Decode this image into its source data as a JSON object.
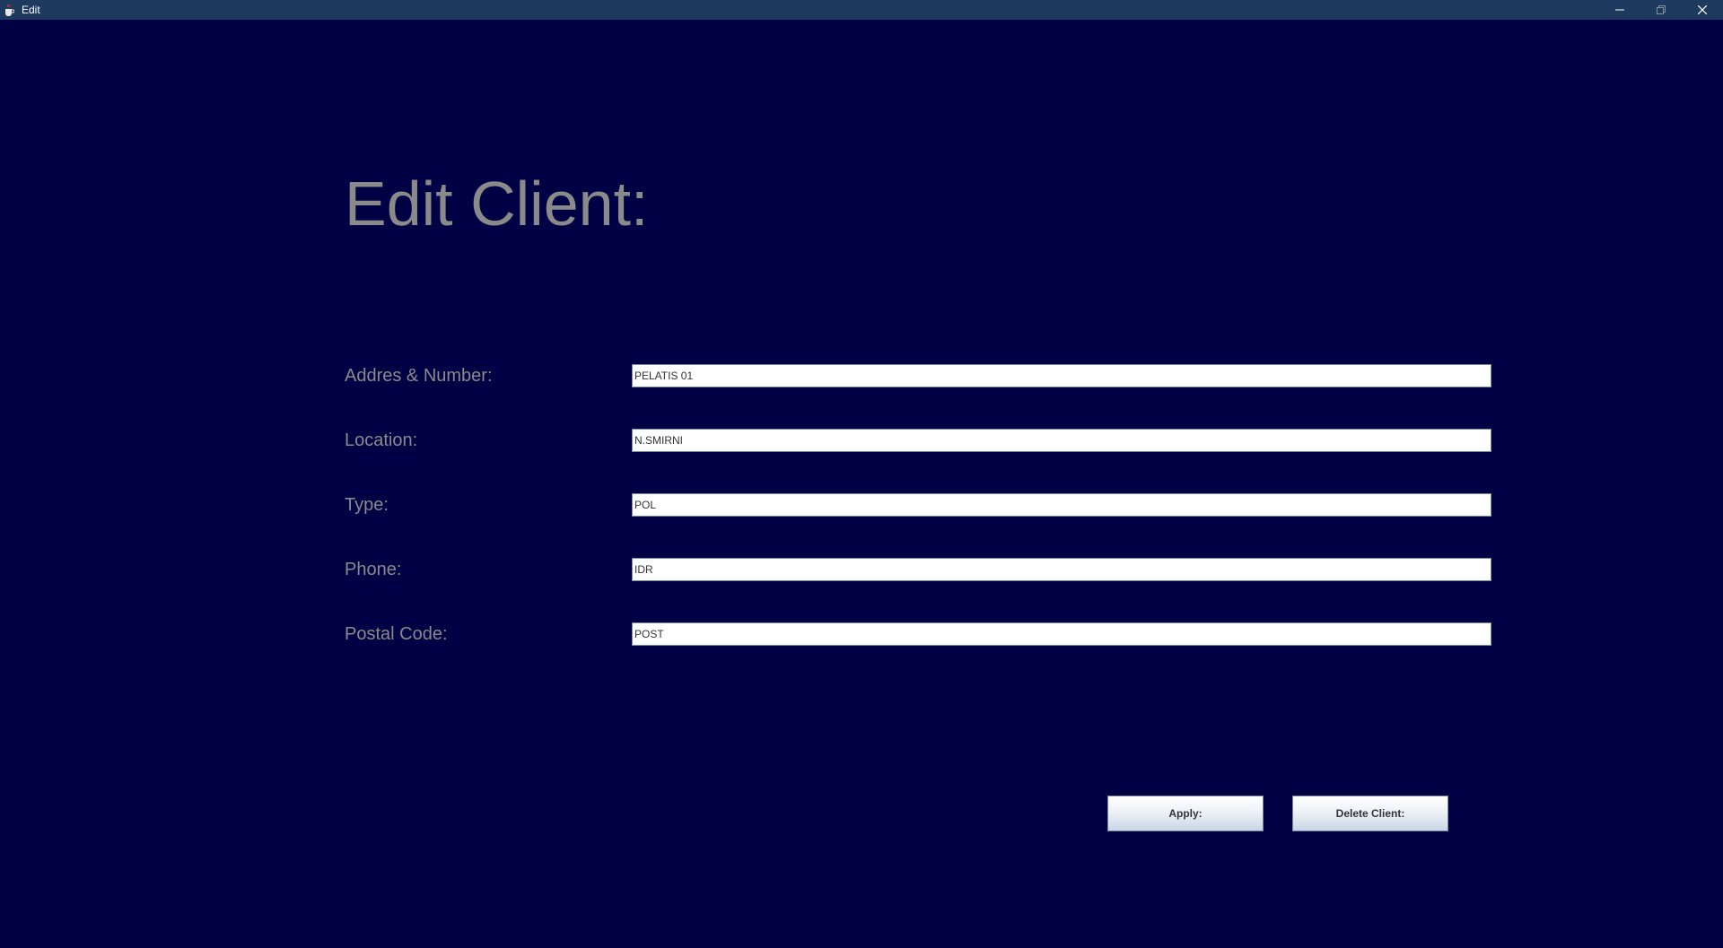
{
  "window": {
    "title": "Edit",
    "icon": "java-cup-icon",
    "controls": [
      "minimize-icon",
      "maximize-icon",
      "close-icon"
    ]
  },
  "form": {
    "heading": "Edit Client:",
    "fields": [
      {
        "label": "Addres & Number:",
        "value": "PELATIS 01"
      },
      {
        "label": "Location:",
        "value": "N.SMIRNI"
      },
      {
        "label": "Type:",
        "value": "POL"
      },
      {
        "label": "Phone:",
        "value": "IDR"
      },
      {
        "label": "Postal Code:",
        "value": "POST"
      }
    ]
  },
  "buttons": {
    "apply": "Apply:",
    "delete": "Delete Client:"
  },
  "colors": {
    "background": "#000044",
    "titlebar": "#1e3a5f",
    "label_text": "#8a8a8a"
  }
}
